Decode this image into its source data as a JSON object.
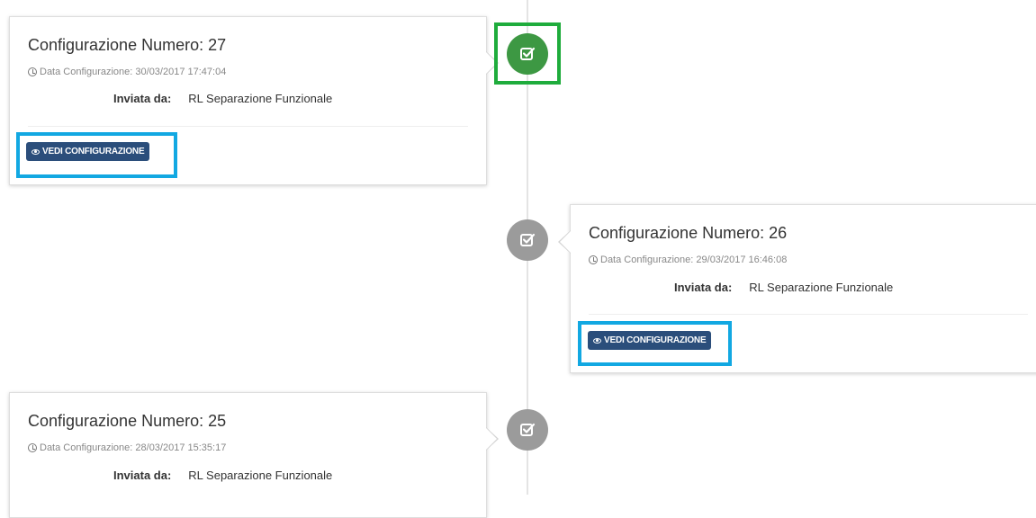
{
  "timeline": {
    "entries": [
      {
        "title": "Configurazione Numero: 27",
        "date": "Data Configurazione: 30/03/2017 17:47:04",
        "sender_label": "Inviata da:",
        "sender_value": "RL Separazione Funzionale",
        "button_label": "VEDI CONFIGURAZIONE",
        "status": "active"
      },
      {
        "title": "Configurazione Numero: 26",
        "date": "Data Configurazione: 29/03/2017 16:46:08",
        "sender_label": "Inviata da:",
        "sender_value": "RL Separazione Funzionale",
        "button_label": "VEDI CONFIGURAZIONE",
        "status": "inactive"
      },
      {
        "title": "Configurazione Numero: 25",
        "date": "Data Configurazione: 28/03/2017 15:35:17",
        "sender_label": "Inviata da:",
        "sender_value": "RL Separazione Funzionale",
        "status": "inactive"
      }
    ]
  },
  "colors": {
    "active_node": "#3d9843",
    "inactive_node": "#9b9b9b",
    "button_bg": "#2b4e7b",
    "button_highlight": "#12a8e2",
    "node_highlight": "#1fac3c"
  },
  "icons": {
    "node_icon": "check-square-icon",
    "date_icon": "clock-icon",
    "button_icon": "eye-icon"
  }
}
